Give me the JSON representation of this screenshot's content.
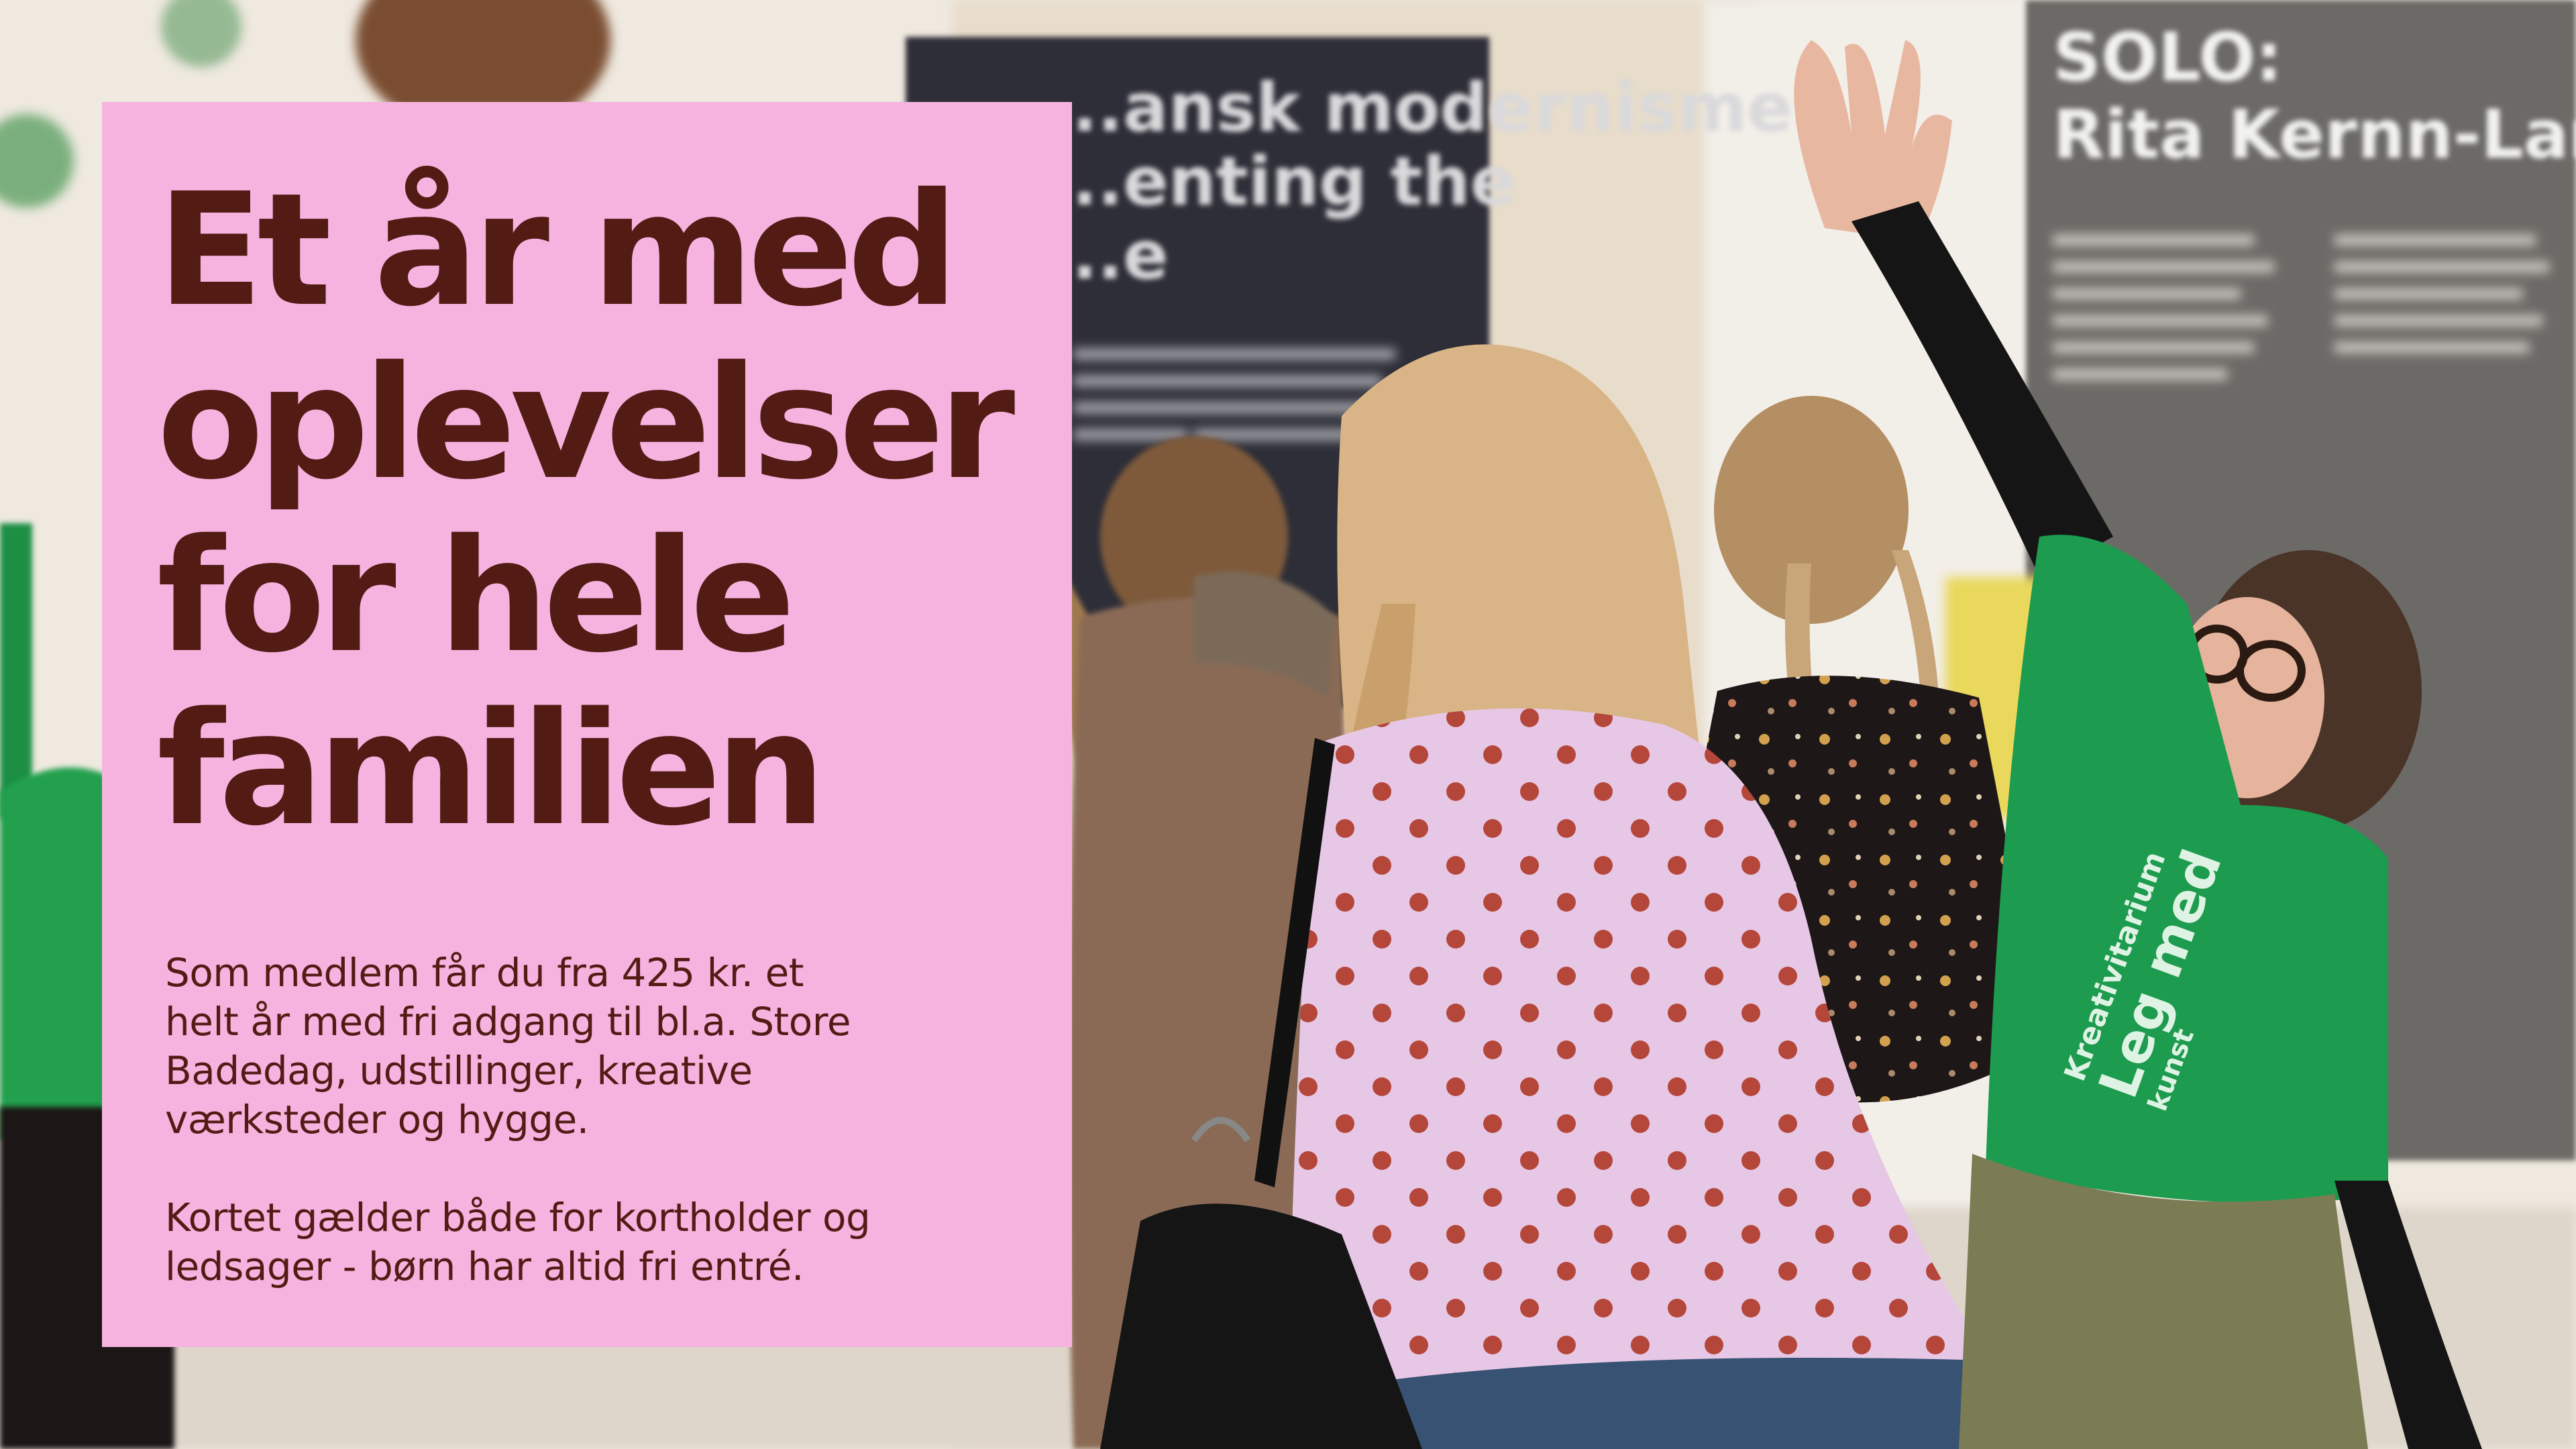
{
  "promo": {
    "headline_lines": [
      "Et år med",
      "oplevelser",
      "for hele",
      "familien"
    ],
    "paragraph_1_lines": [
      "Som medlem får du fra 425 kr. et",
      "helt år med fri adgang til bl.a. Store",
      "Badedag, udstillinger, kreative",
      "værksteder og hygge."
    ],
    "paragraph_2_lines": [
      "Kortet gælder både for kortholder og",
      "ledsager - børn har altid fri entré."
    ]
  },
  "background": {
    "sign_left_lines": [
      "...ansk modernisme",
      "...enting the",
      "...e"
    ],
    "sign_right_lines": [
      "SOLO:",
      "Rita Kernn-Larsen"
    ],
    "shirt_text_lines": [
      "Kreativitarium",
      "Leg med",
      "kunst"
    ]
  },
  "colors": {
    "panel": "#f6b3e0",
    "text": "#521c15",
    "shirt": "#1d9b4e",
    "sign_dark": "#2f2f37",
    "sign_grey": "#6c6b66"
  }
}
